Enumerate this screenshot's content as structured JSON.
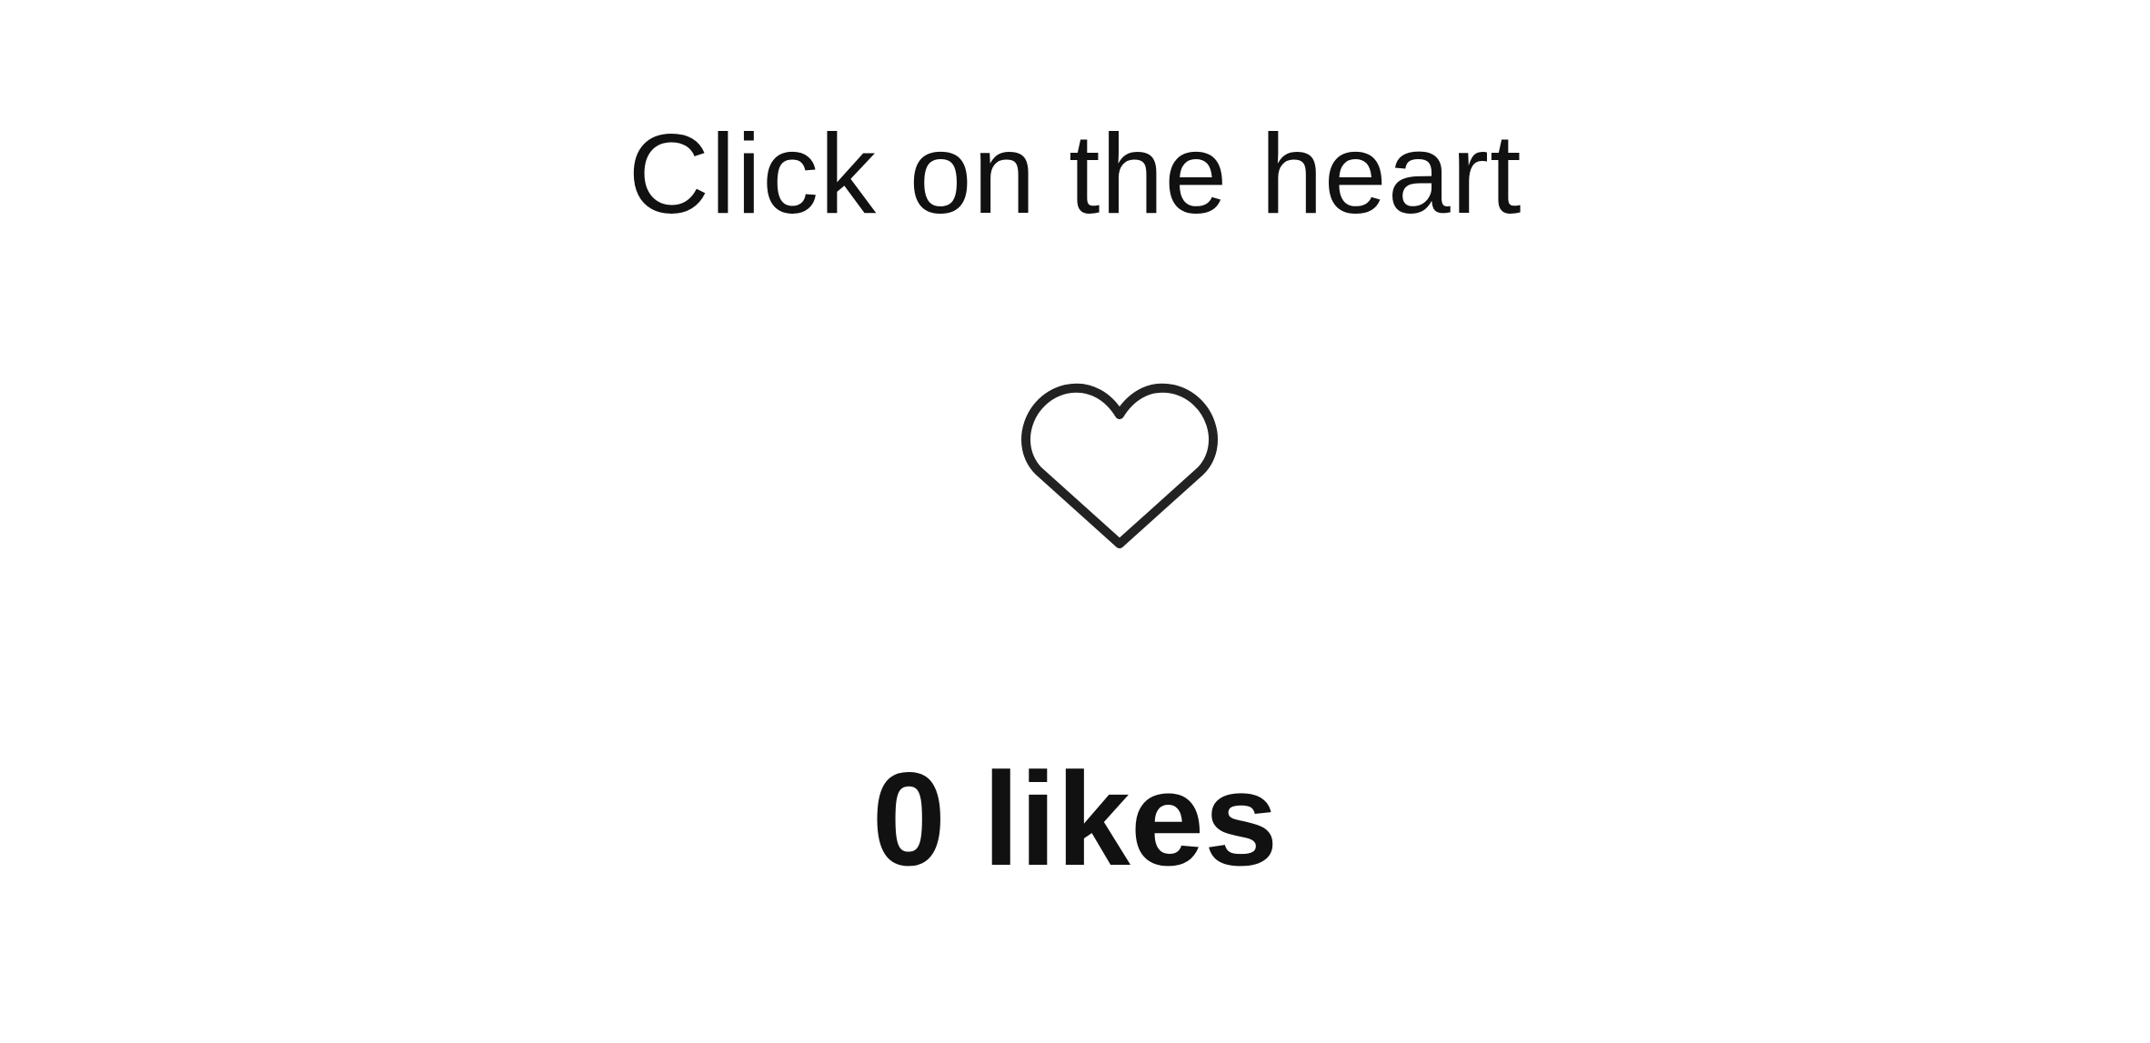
{
  "prompt": {
    "text": "Click on the heart"
  },
  "like_button": {
    "icon": "heart-outline-icon",
    "liked": false
  },
  "likes": {
    "count": "0",
    "unit": "likes"
  },
  "colors": {
    "background": "#ffffff",
    "text": "#111111",
    "heart_stroke": "#222222"
  }
}
